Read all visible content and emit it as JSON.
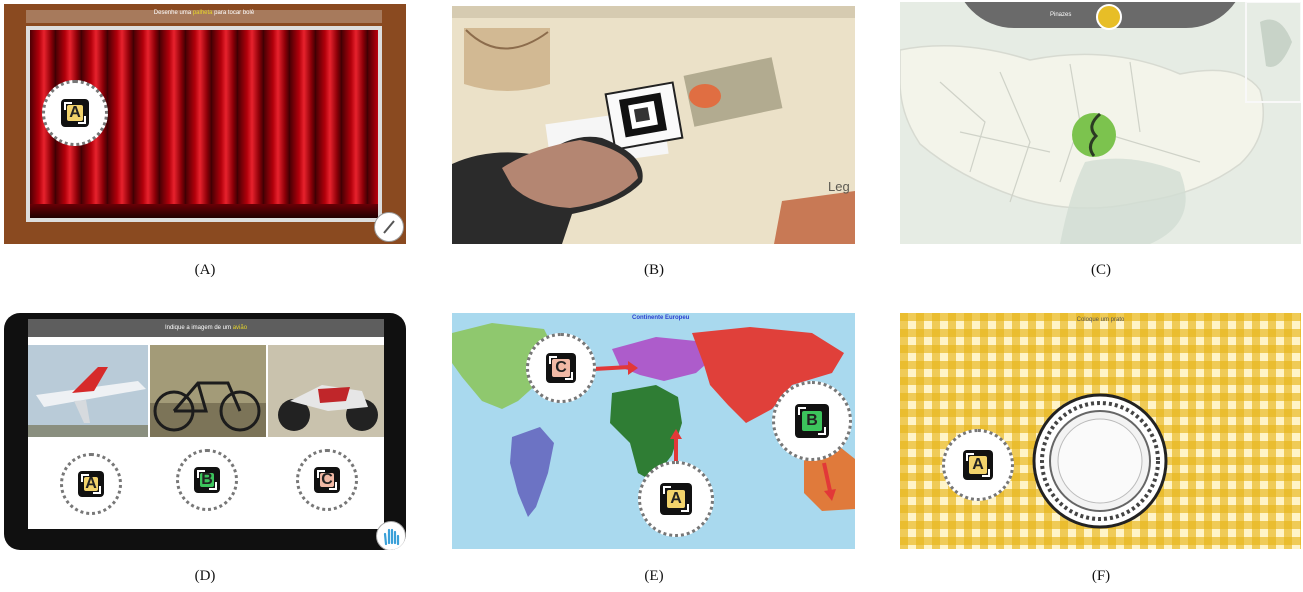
{
  "panels": {
    "a": {
      "caption": "(A)",
      "header_pre": "Desenhe uma ",
      "header_mid": "palheta",
      "header_post": " para tocar bolê",
      "marker": "A"
    },
    "b": {
      "caption": "(B)",
      "label": "Leg"
    },
    "c": {
      "caption": "(C)",
      "label": "Pinazes"
    },
    "d": {
      "caption": "(D)",
      "header_pre": "Indique a imagem de um ",
      "header_mid": "avião",
      "markers": [
        "A",
        "B",
        "C"
      ]
    },
    "e": {
      "caption": "(E)",
      "title": "Continente Europeu",
      "markers": [
        "C",
        "B",
        "A"
      ]
    },
    "f": {
      "caption": "(F)",
      "title": "Coloque um prato",
      "marker": "A"
    }
  },
  "colors": {
    "tile_a": "#f2d36b",
    "tile_b": "#3cc45c",
    "tile_c": "#f1b9a5",
    "accent": "#e6d52a"
  }
}
